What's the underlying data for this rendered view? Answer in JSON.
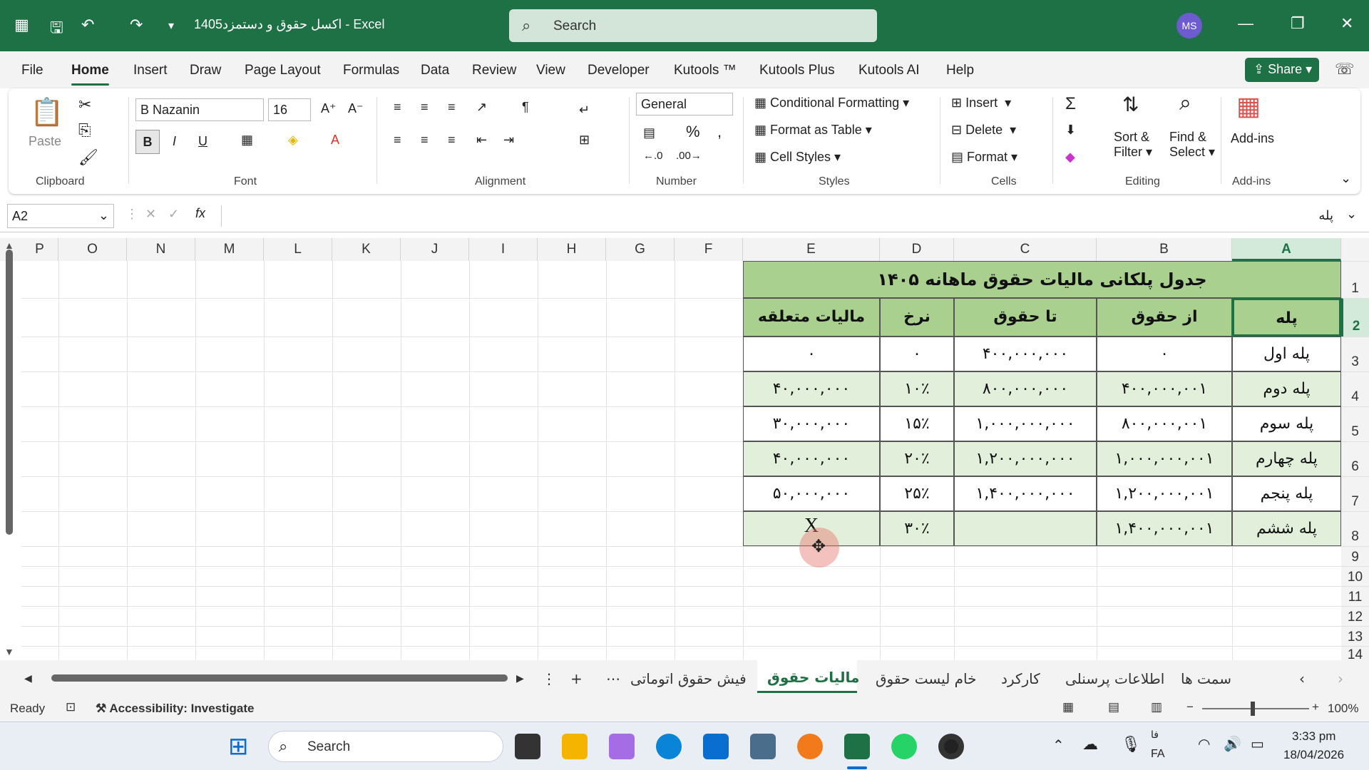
{
  "titlebar": {
    "file_name": "اکسل حقوق و دستمزد1405",
    "separator": "-",
    "app": "Excel",
    "search": "Search",
    "avatar": "MS"
  },
  "menu": {
    "tabs": [
      "File",
      "Home",
      "Insert",
      "Draw",
      "Page Layout",
      "Formulas",
      "Data",
      "Review",
      "View",
      "Developer",
      "Kutools ™",
      "Kutools Plus",
      "Kutools AI",
      "Help"
    ],
    "share": "Share"
  },
  "ribbon": {
    "paste": "Paste",
    "font_name": "B Nazanin",
    "font_size": "16",
    "number_format": "General",
    "conditional_formatting": "Conditional Formatting",
    "format_as_table": "Format as Table",
    "cell_styles": "Cell Styles",
    "insert": "Insert",
    "delete": "Delete",
    "format": "Format",
    "sort_filter_1": "Sort &",
    "sort_filter_2": "Filter",
    "find_select_1": "Find &",
    "find_select_2": "Select",
    "add_ins": "Add-ins",
    "groups": {
      "clipboard": "Clipboard",
      "font": "Font",
      "alignment": "Alignment",
      "number": "Number",
      "styles": "Styles",
      "cells": "Cells",
      "editing": "Editing",
      "addins": "Add-ins"
    }
  },
  "formula": {
    "namebox": "A2",
    "fx": "fx",
    "content": "پله"
  },
  "columns": [
    "P",
    "O",
    "N",
    "M",
    "L",
    "K",
    "J",
    "I",
    "H",
    "G",
    "F",
    "E",
    "D",
    "C",
    "B",
    "A"
  ],
  "rows": [
    "1",
    "2",
    "3",
    "4",
    "5",
    "6",
    "7",
    "8",
    "9",
    "10",
    "11",
    "12",
    "13",
    "14"
  ],
  "table": {
    "title": "جدول پلکانی مالیات حقوق ماهانه ۱۴۰۵",
    "headers": [
      "پله",
      "از حقوق",
      "تا حقوق",
      "نرخ",
      "مالیات متعلقه"
    ],
    "rows": [
      [
        "پله اول",
        "۰",
        "۴۰۰,۰۰۰,۰۰۰",
        "۰",
        "۰"
      ],
      [
        "پله دوم",
        "۴۰۰,۰۰۰,۰۰۱",
        "۸۰۰,۰۰۰,۰۰۰",
        "۱۰٪",
        "۴۰,۰۰۰,۰۰۰"
      ],
      [
        "پله سوم",
        "۸۰۰,۰۰۰,۰۰۱",
        "۱,۰۰۰,۰۰۰,۰۰۰",
        "۱۵٪",
        "۳۰,۰۰۰,۰۰۰"
      ],
      [
        "پله چهارم",
        "۱,۰۰۰,۰۰۰,۰۰۱",
        "۱,۲۰۰,۰۰۰,۰۰۰",
        "۲۰٪",
        "۴۰,۰۰۰,۰۰۰"
      ],
      [
        "پله پنجم",
        "۱,۲۰۰,۰۰۰,۰۰۱",
        "۱,۴۰۰,۰۰۰,۰۰۰",
        "۲۵٪",
        "۵۰,۰۰۰,۰۰۰"
      ],
      [
        "پله ششم",
        "۱,۴۰۰,۰۰۰,۰۰۱",
        "",
        "۳۰٪",
        "X"
      ]
    ]
  },
  "sheets": {
    "tabs": [
      "سمت ها",
      "اطلاعات پرسنلی",
      "کارکرد",
      "خام لیست حقوق",
      "مالیات حقوق",
      "فیش حقوق اتوماتی"
    ],
    "active": "مالیات حقوق",
    "more": "⋯",
    "add": "+"
  },
  "status": {
    "ready": "Ready",
    "accessibility": "Accessibility: Investigate",
    "zoom": "100%"
  },
  "taskbar": {
    "search": "Search",
    "lang_top": "فا",
    "lang": "FA",
    "time": "3:33 pm",
    "date": "18/04/2026"
  },
  "colors": {
    "accent": "#1e7145",
    "header_fill": "#a9d08e",
    "band_fill": "#e2efda"
  }
}
